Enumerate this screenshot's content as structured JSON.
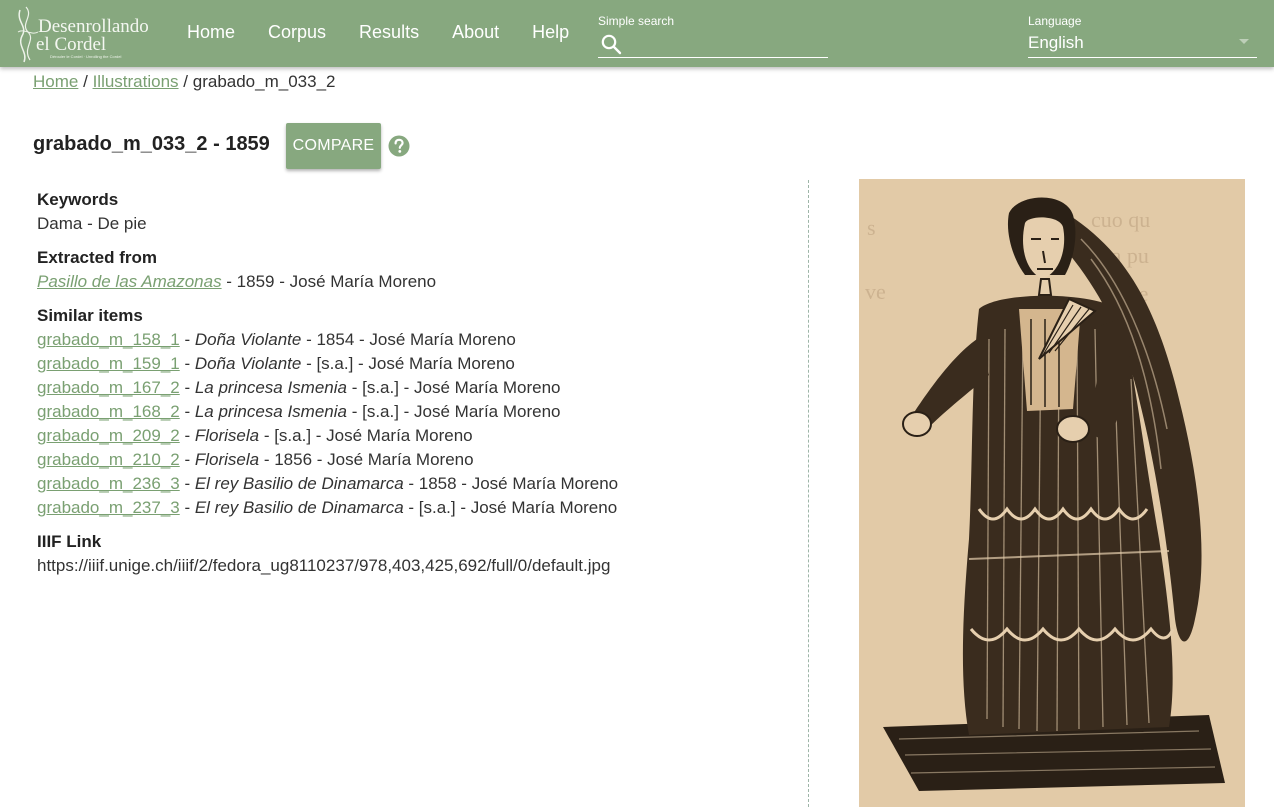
{
  "header": {
    "logo_text": "Desenrollando el Cordel",
    "logo_subtitle": "Dérouler le Cordel · Unrolling the Cordel",
    "nav": [
      {
        "label": "Home"
      },
      {
        "label": "Corpus"
      },
      {
        "label": "Results"
      },
      {
        "label": "About"
      },
      {
        "label": "Help"
      }
    ],
    "search": {
      "label": "Simple search",
      "value": "",
      "icon": "search-icon"
    },
    "language": {
      "label": "Language",
      "value": "English",
      "icon": "caret-down-icon"
    }
  },
  "breadcrumb": {
    "home": "Home",
    "sep1": "/",
    "section": "Illustrations",
    "sep2": "/",
    "current": "grabado_m_033_2"
  },
  "title": "grabado_m_033_2 - 1859",
  "compare_label": "COMPARE",
  "help_icon": "question-icon",
  "keywords": {
    "heading": "Keywords",
    "value": "Dama - De pie"
  },
  "extracted_from": {
    "heading": "Extracted from",
    "title": "Pasillo de las Amazonas",
    "details": " - 1859 - José María Moreno"
  },
  "similar": {
    "heading": "Similar items",
    "items": [
      {
        "id": "grabado_m_158_1",
        "title": "Doña Violante",
        "details": " - 1854 - José María Moreno"
      },
      {
        "id": "grabado_m_159_1",
        "title": "Doña Violante",
        "details": " - [s.a.] - José María Moreno"
      },
      {
        "id": "grabado_m_167_2",
        "title": "La princesa Ismenia",
        "details": " - [s.a.] - José María Moreno"
      },
      {
        "id": "grabado_m_168_2",
        "title": "La princesa Ismenia",
        "details": " - [s.a.] - José María Moreno"
      },
      {
        "id": "grabado_m_209_2",
        "title": "Florisela",
        "details": " - [s.a.] - José María Moreno"
      },
      {
        "id": "grabado_m_210_2",
        "title": "Florisela",
        "details": " - 1856 - José María Moreno"
      },
      {
        "id": "grabado_m_236_3",
        "title": "El rey Basilio de Dinamarca",
        "details": " - 1858 - José María Moreno"
      },
      {
        "id": "grabado_m_237_3",
        "title": "El rey Basilio de Dinamarca",
        "details": " - [s.a.] - José María Moreno"
      }
    ]
  },
  "iiif": {
    "heading": "IIIF Link",
    "url": "https://iiif.unige.ch/iiif/2/fedora_ug8110237/978,403,425,692/full/0/default.jpg"
  },
  "colors": {
    "header_bg": "#87a87f",
    "link": "#7aa072",
    "paper": "#e6cfae",
    "ink": "#2a2016"
  }
}
